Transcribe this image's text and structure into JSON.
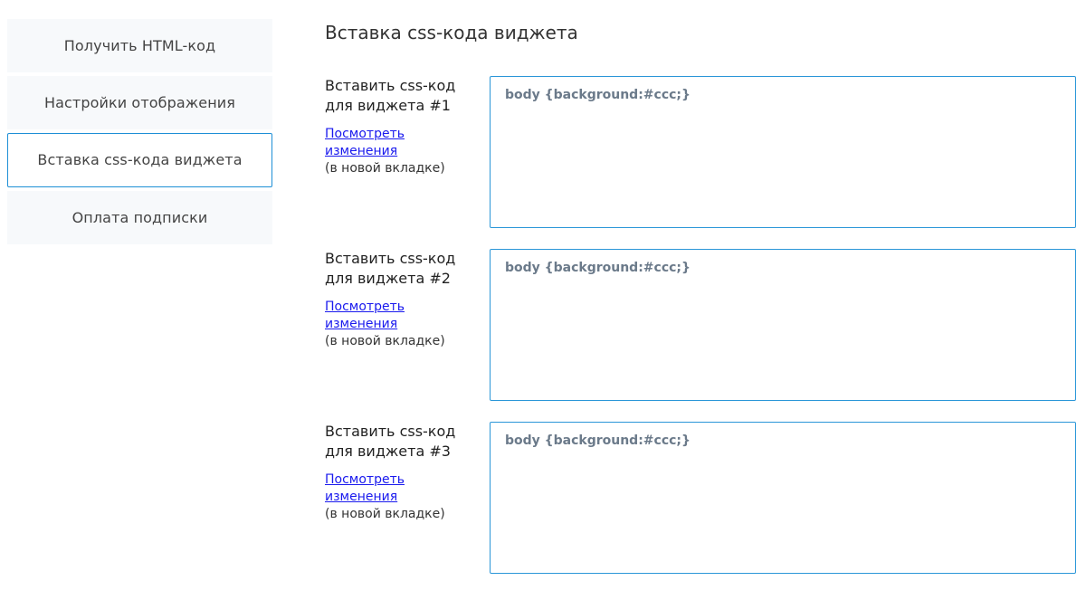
{
  "sidebar": {
    "items": [
      {
        "label": "Получить HTML-код"
      },
      {
        "label": "Настройки отображения"
      },
      {
        "label": "Вставка css-кода виджета"
      },
      {
        "label": "Оплата подписки"
      }
    ]
  },
  "main": {
    "title": "Вставка css-кода виджета",
    "rows": [
      {
        "title_line1": "Вставить css-код",
        "title_line2": "для виджета #1",
        "link": "Посмотреть изменения",
        "note": "(в новой вкладке)",
        "value": "body {background:#ccc;}"
      },
      {
        "title_line1": "Вставить css-код",
        "title_line2": "для виджета #2",
        "link": "Посмотреть изменения",
        "note": "(в новой вкладке)",
        "value": "body {background:#ccc;}"
      },
      {
        "title_line1": "Вставить css-код",
        "title_line2": "для виджета #3",
        "link": "Посмотреть изменения",
        "note": "(в новой вкладке)",
        "value": "body {background:#ccc;}"
      }
    ]
  },
  "colors": {
    "accent": "#1e8fd6",
    "link": "#1a1aee",
    "sidebar_bg": "#f7f9fb",
    "code_text": "#6b7a8a"
  }
}
